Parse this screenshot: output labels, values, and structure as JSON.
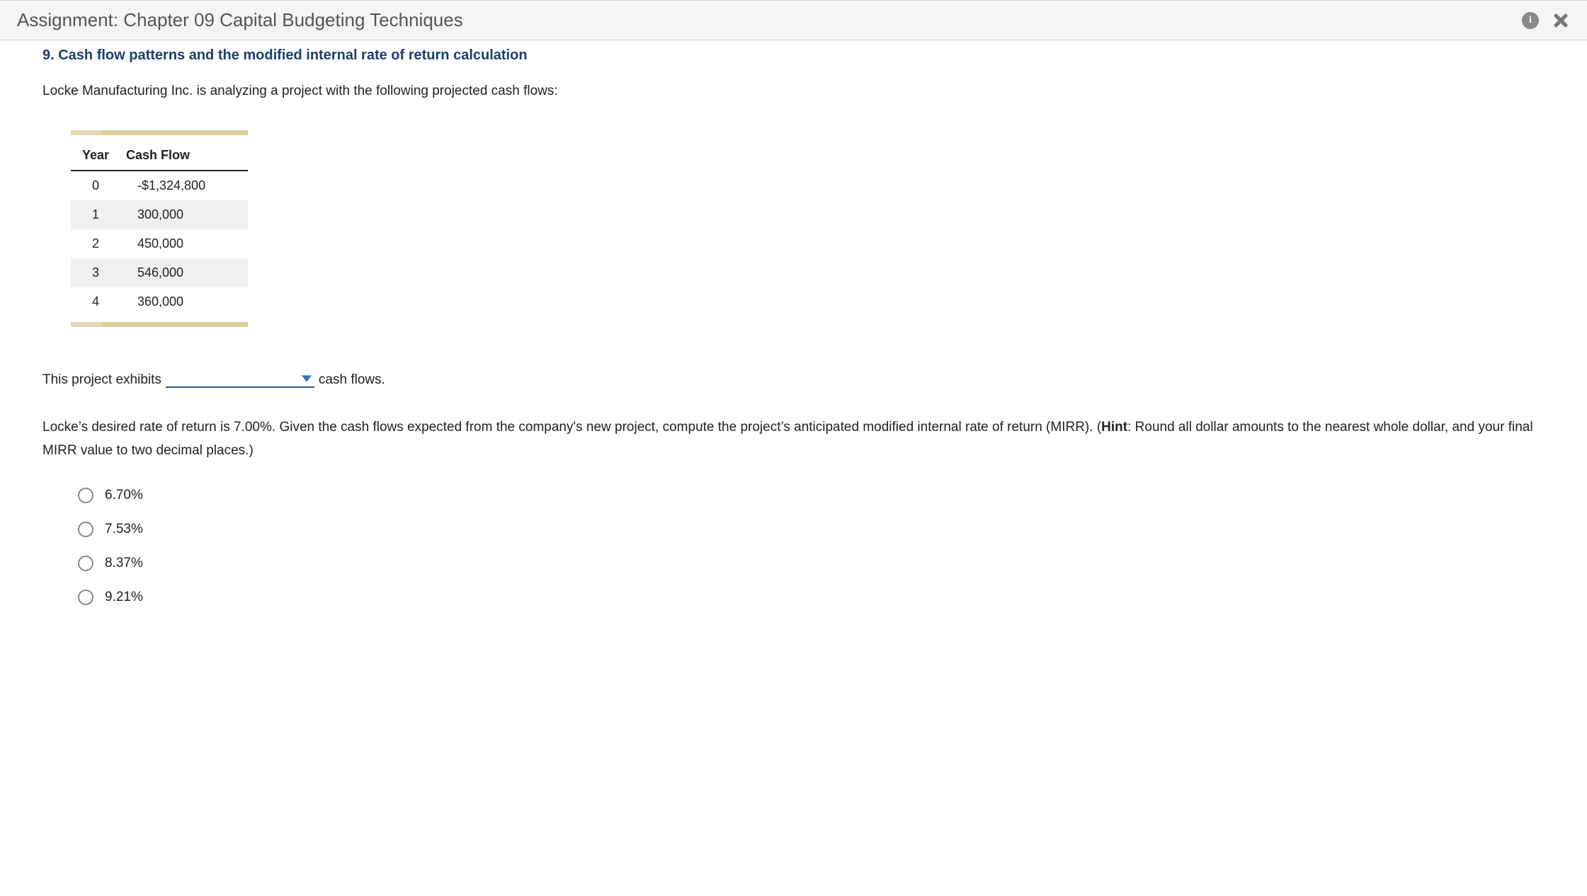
{
  "header": {
    "title": "Assignment: Chapter 09 Capital Budgeting Techniques"
  },
  "question": {
    "heading": "9. Cash flow patterns and the modified internal rate of return calculation",
    "intro": "Locke Manufacturing Inc. is analyzing a project with the following projected cash flows:",
    "table": {
      "headers": {
        "year": "Year",
        "cashflow": "Cash Flow"
      },
      "rows": [
        {
          "year": "0",
          "flow": "-$1,324,800"
        },
        {
          "year": "1",
          "flow": "300,000"
        },
        {
          "year": "2",
          "flow": "450,000"
        },
        {
          "year": "3",
          "flow": "546,000"
        },
        {
          "year": "4",
          "flow": "360,000"
        }
      ]
    },
    "blank_sentence": {
      "before": "This project exhibits",
      "after": "cash flows."
    },
    "mirr_paragraph": {
      "text_before_hint": "Locke’s desired rate of return is 7.00%. Given the cash flows expected from the company's new project, compute the project’s anticipated modified internal rate of return (MIRR). (",
      "hint_label": "Hint",
      "text_after_hint": ": Round all dollar amounts to the nearest whole dollar, and your final MIRR value to two decimal places.)"
    },
    "options": [
      "6.70%",
      "7.53%",
      "8.37%",
      "9.21%"
    ]
  }
}
